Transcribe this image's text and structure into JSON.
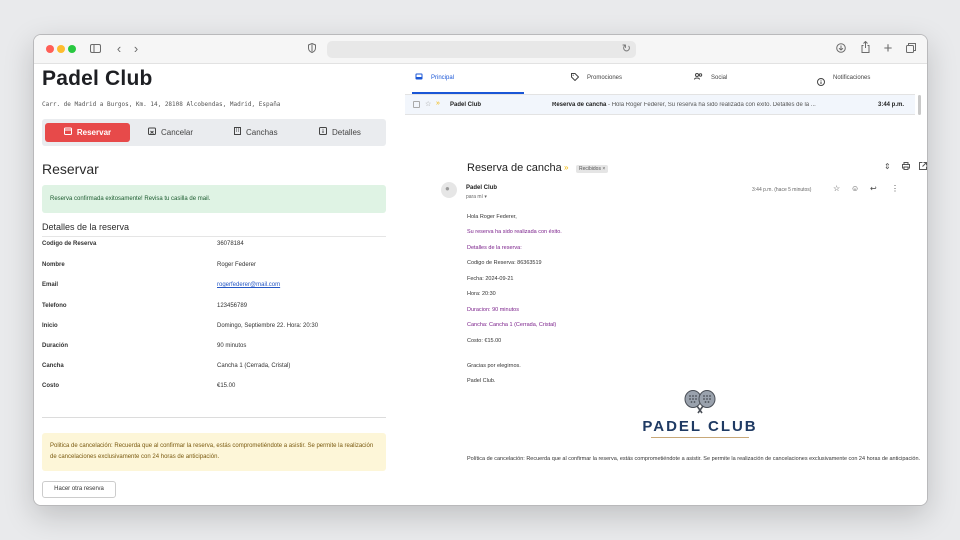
{
  "browser": {
    "url": ""
  },
  "app": {
    "title": "Padel Club",
    "address": "Carr. de Madrid a Burgos, Km. 14, 28108 Alcobendas, Madrid, España",
    "nav": [
      {
        "label": "Reservar",
        "icon": "calendar-icon",
        "active": true
      },
      {
        "label": "Cancelar",
        "icon": "calendar-x-icon"
      },
      {
        "label": "Canchas",
        "icon": "building-icon"
      },
      {
        "label": "Detalles",
        "icon": "info-icon"
      }
    ],
    "section_title": "Reservar",
    "success_message": "Reserva confirmada exitosamente! Revisa tu casilla de mail.",
    "details_title": "Detalles de la reserva",
    "details": [
      {
        "key": "Codigo de Reserva",
        "value": "36078184"
      },
      {
        "key": "Nombre",
        "value": "Roger Federer"
      },
      {
        "key": "Email",
        "value": "rogerfederer@mail.com"
      },
      {
        "key": "Telefono",
        "value": "123456789"
      },
      {
        "key": "Inicio",
        "value": "Domingo, Septiembre 22. Hora: 20:30"
      },
      {
        "key": "Duración",
        "value": "90 minutos"
      },
      {
        "key": "Cancha",
        "value": "Cancha 1 (Cerrada, Cristal)"
      },
      {
        "key": "Costo",
        "value": "€15.00"
      }
    ],
    "policy": "Politica de cancelación: Recuerda que al confirmar la reserva, estás comprometiéndote a asistir. Se permite la realización de cancelaciones exclusivamente con 24 horas de anticipación.",
    "again_button": "Hacer otra reserva"
  },
  "mail": {
    "tabs": [
      {
        "label": "Principal",
        "icon": "inbox-icon",
        "active": true
      },
      {
        "label": "Promociones",
        "icon": "tag-icon"
      },
      {
        "label": "Social",
        "icon": "people-icon"
      },
      {
        "label": "Notificaciones",
        "icon": "info-icon"
      }
    ],
    "inbox_row": {
      "from": "Padel Club",
      "subject": "Reserva de cancha",
      "snippet": " - Hola Roger Federer, Su reserva ha sido realizada con éxito. Detalles de la ...",
      "time": "3:44 p.m."
    },
    "message": {
      "subject": "Reserva de cancha",
      "label": "Recibidos ×",
      "sender": "Padel Club",
      "to": "para mí ▾",
      "time": "3:44 p.m. (hace 5 minutos)",
      "lines": [
        {
          "text": "Hola Roger Federer,",
          "purple": false
        },
        {
          "text": "Su reserva ha sido realizada con éxito.",
          "purple": true
        },
        {
          "text": "Detalles de la reserva:",
          "purple": true
        },
        {
          "text": "Codigo de Reserva: 86363519",
          "purple": false
        },
        {
          "text": "Fecha: 2024-09-21",
          "purple": false
        },
        {
          "text": "Hora: 20:30",
          "purple": false
        },
        {
          "text": "Duracion: 90 minutos",
          "purple": true
        },
        {
          "text": "Cancha: Cancha 1 (Cerrada, Cristal)",
          "purple": true
        },
        {
          "text": "Costo: €15.00",
          "purple": false
        },
        {
          "text": "Gracias por elegirnos.",
          "purple": false
        },
        {
          "text": "Padel Club.",
          "purple": false
        }
      ],
      "logo_text": "PADEL CLUB",
      "policy": "Política de cancelación: Recuerda que al confirmar la reserva, estás comprometiéndote a asistir. Se permite la realización de cancelaciones exclusivamente con 24 horas de anticipación."
    }
  },
  "colors": {
    "accent": "#e74a4a",
    "link": "#1a56d6",
    "success_bg": "#dff3e4",
    "warning_bg": "#fdf6d8",
    "logo": "#1f3a63"
  }
}
